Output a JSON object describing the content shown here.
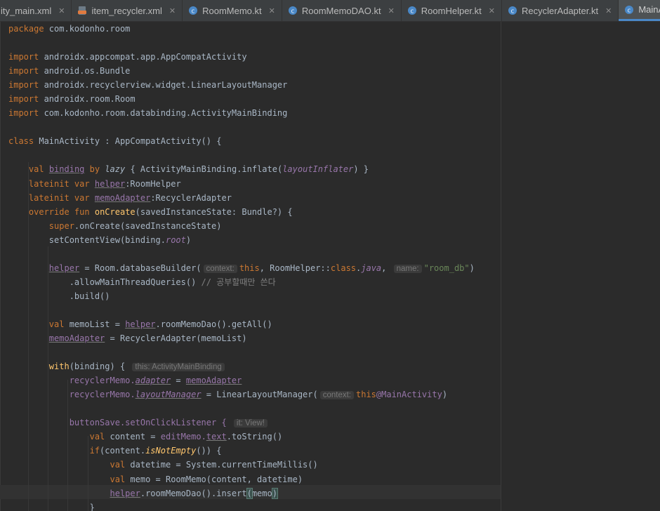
{
  "tabs": [
    {
      "label": "ity_main.xml",
      "icon": "xml-file-icon",
      "closable": true,
      "active": false
    },
    {
      "label": "item_recycler.xml",
      "icon": "xml-file-icon",
      "closable": true,
      "active": false
    },
    {
      "label": "RoomMemo.kt",
      "icon": "kotlin-class-icon",
      "closable": true,
      "active": false
    },
    {
      "label": "RoomMemoDAO.kt",
      "icon": "kotlin-class-icon",
      "closable": true,
      "active": false
    },
    {
      "label": "RoomHelper.kt",
      "icon": "kotlin-class-icon",
      "closable": true,
      "active": false
    },
    {
      "label": "RecyclerAdapter.kt",
      "icon": "kotlin-class-icon",
      "closable": true,
      "active": false
    },
    {
      "label": "MainActivity.kt",
      "icon": "kotlin-class-icon",
      "closable": true,
      "active": true
    }
  ],
  "colors": {
    "background": "#2b2b2b",
    "keyword": "#cc7832",
    "function": "#ffc66d",
    "string": "#6a8759",
    "property": "#9876aa",
    "comment": "#808080",
    "text": "#a9b7c6",
    "active_tab_underline": "#4a88c7"
  },
  "code": {
    "package_kw": "package",
    "package_name": " com.kodonho.room",
    "import_kw": "import",
    "imports": [
      " androidx.appcompat.app.AppCompatActivity",
      " android.os.Bundle",
      " androidx.recyclerview.widget.LinearLayoutManager",
      " androidx.room.Room",
      " com.kodonho.room.databinding.ActivityMainBinding"
    ],
    "class_kw": "class",
    "class_decl": " MainActivity : AppCompatActivity() {",
    "val_kw": "val",
    "binding_name": "binding",
    "by_kw": "by",
    "lazy_fn": "lazy",
    "binding_init_a": " { ActivityMainBinding.inflate(",
    "layout_inflater": "layoutInflater",
    "binding_init_b": ") }",
    "lateinit_var": "lateinit var",
    "helper_name": "helper",
    "helper_type": ":RoomHelper",
    "memo_adapter_name": "memoAdapter",
    "memo_adapter_type": ":RecyclerAdapter",
    "override_fun": "override fun",
    "on_create": "onCreate",
    "on_create_params": "(savedInstanceState: Bundle?) {",
    "super_kw": "super",
    "super_call": ".onCreate(savedInstanceState)",
    "set_content_a": "setContentView(binding.",
    "root_prop": "root",
    "set_content_b": ")",
    "helper_assign_a": " = Room.databaseBuilder(",
    "hint_context": "context:",
    "this_kw": "this",
    "helper_assign_b": ", RoomHelper::",
    "class_kw2": "class",
    "dot": ".",
    "java_prop": "java",
    "comma": ",",
    "hint_name": "name:",
    "db_name": "\"room_db\"",
    "close_paren": ")",
    "allow_main": ".allowMainThreadQueries() ",
    "comment": "// 공부할때만 쓴다",
    "build": ".build()",
    "memo_list_decl": " memoList = ",
    "memo_list_call": ".roomMemoDao().getAll()",
    "memo_adapter_assign": " = RecyclerAdapter(memoList)",
    "with_fn": "with",
    "with_args": "(binding) {",
    "hint_this": "this: ActivityMainBinding",
    "recycler_memo": "recyclerMemo.",
    "adapter_prop": "adapter",
    "assign": " = ",
    "layout_manager_prop": "layoutManager",
    "layout_manager_call": " = LinearLayoutManager(",
    "this_main": "@MainActivity",
    "button_save": "buttonSave.setOnClickListener {",
    "hint_it": "it: View!",
    "content_decl": " content = ",
    "edit_memo": "editMemo.",
    "text_prop": "text",
    "to_string": ".toString()",
    "if_kw": "if",
    "if_a": "(content.",
    "is_not_empty": "isNotEmpty",
    "if_b": "()) {",
    "datetime_decl": " datetime = System.currentTimeMillis()",
    "memo_decl": " memo = RoomMemo(content, datetime)",
    "insert_call_a": ".roomMemoDao().insert",
    "open_paren": "(",
    "memo_arg": "memo",
    "close_brace": "}"
  }
}
